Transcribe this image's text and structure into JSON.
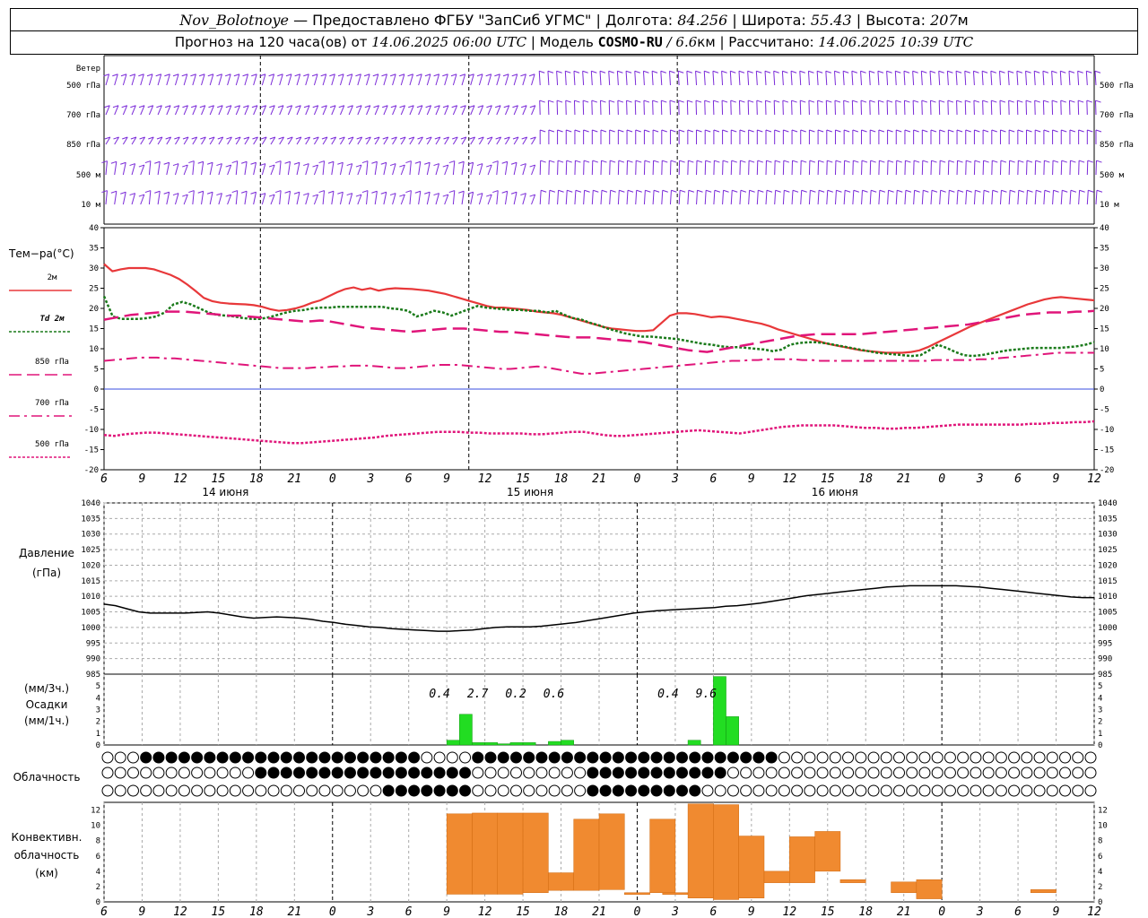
{
  "header": {
    "station": "Nov_Bolotnoye",
    "provider": " — Предоставлено ФГБУ \"ЗапСиб УГМС\" | Долгота: ",
    "lon": "84.256",
    "lat_label": " | Широта: ",
    "lat": "55.43",
    "alt_label": " | Высота: ",
    "alt": "207",
    "alt_unit": "м",
    "forecast_label": "Прогноз на 120 часа(ов) от ",
    "forecast_time": "14.06.2025 06:00 UTC",
    "model_label": " | Модель ",
    "model": "COSMO-RU",
    "model_res": " / 6.6",
    "model_res_unit": "км",
    "calc_label": " | Рассчитано: ",
    "calc_time": "14.06.2025 10:39 UTC"
  },
  "wind_panel": {
    "title": "Ветер",
    "levels": [
      "500 гПа",
      "700 гПа",
      "850 гПа",
      "500 м",
      "10  м"
    ],
    "color": "#7a2ad8"
  },
  "x_axis": {
    "hour_labels": [
      "6",
      "9",
      "12",
      "15",
      "18",
      "21",
      "0",
      "3",
      "6",
      "9",
      "12",
      "15",
      "18",
      "21",
      "0",
      "3",
      "6",
      "9",
      "12",
      "15",
      "18",
      "21",
      "0",
      "3",
      "6",
      "9",
      "12"
    ],
    "day_labels": [
      "14 июня",
      "15 июня",
      "16 июня"
    ]
  },
  "temperature_panel": {
    "title": "Тем−ра(°С)",
    "legend": [
      {
        "label": "2м",
        "color": "#e8383a",
        "style": "solid"
      },
      {
        "label": "Td  2м",
        "color": "#1a7a1a",
        "style": "dotted"
      },
      {
        "label": "850 гПа",
        "color": "#e0157a",
        "style": "dashed"
      },
      {
        "label": "700 гПа",
        "color": "#e0157a",
        "style": "dashdot"
      },
      {
        "label": "500 гПа",
        "color": "#e0157a",
        "style": "dense-dotted"
      }
    ],
    "ylim": [
      -20,
      40
    ],
    "yticks": [
      -20,
      -15,
      -10,
      -5,
      0,
      5,
      10,
      15,
      20,
      25,
      30,
      35,
      40
    ]
  },
  "pressure_panel": {
    "title": "Давление",
    "unit": "(гПа)",
    "ylim": [
      985,
      1040
    ],
    "yticks": [
      985,
      990,
      995,
      1000,
      1005,
      1010,
      1015,
      1020,
      1025,
      1030,
      1035,
      1040
    ]
  },
  "precip_panel": {
    "title_units_3h": "(мм/3ч.)",
    "title": "Осадки",
    "title_units_1h": "(мм/1ч.)",
    "ylim": [
      0,
      6
    ],
    "yticks": [
      0,
      1,
      2,
      3,
      4,
      5
    ],
    "totals": [
      {
        "x": 27,
        "text": "0.4"
      },
      {
        "x": 30,
        "text": "2.7"
      },
      {
        "x": 33,
        "text": "0.2"
      },
      {
        "x": 36,
        "text": "0.6"
      },
      {
        "x": 45,
        "text": "0.4"
      },
      {
        "x": 48,
        "text": "9.6"
      }
    ]
  },
  "cloud_panel": {
    "title": "Облачность"
  },
  "convective_panel": {
    "title_line1": "Конвективн.",
    "title_line2": "облачность",
    "title_line3": "(км)",
    "ylim": [
      0,
      13
    ],
    "yticks": [
      0,
      2,
      4,
      6,
      8,
      10,
      12
    ]
  },
  "chart_data": [
    {
      "type": "line",
      "title": "Тем−ра(°С)",
      "xlabel": "",
      "ylabel": "",
      "x_hours_from_start": [
        0,
        1,
        2,
        3,
        4,
        5,
        6,
        7,
        8,
        9,
        10,
        11,
        12,
        13,
        14,
        15,
        16,
        17,
        18,
        19,
        20,
        21,
        22,
        23,
        24,
        25,
        26,
        27,
        28,
        29,
        30,
        31,
        32,
        33,
        34,
        35,
        36,
        37,
        38,
        39,
        40,
        41,
        42,
        43,
        44,
        45,
        46,
        47,
        48,
        49,
        50,
        51,
        52,
        53,
        54,
        55,
        56,
        57,
        58,
        59,
        60,
        61,
        62,
        63,
        64,
        65,
        66,
        67,
        68,
        69,
        70,
        71,
        72,
        73,
        74,
        75,
        76,
        77,
        78,
        79,
        80,
        81,
        82,
        83,
        84,
        85,
        86,
        87,
        88,
        89,
        90,
        91,
        92,
        93,
        94,
        95,
        96,
        97,
        98,
        99,
        100,
        101,
        102,
        103,
        104,
        105,
        106,
        107,
        108,
        109,
        110,
        111,
        112,
        113,
        114,
        115,
        116,
        117,
        118,
        119,
        120,
        121,
        122,
        123,
        124,
        125,
        126,
        127,
        128,
        129,
        130,
        131,
        132,
        133,
        134,
        135,
        136,
        137,
        138,
        139,
        140,
        141,
        142,
        143,
        144,
        145,
        146,
        147,
        148,
        149,
        150,
        151,
        152,
        153,
        154,
        155,
        156,
        157,
        158,
        159
      ],
      "ylim": [
        -20,
        40
      ],
      "series": [
        {
          "name": "2м",
          "values": [
            31.0,
            29.2,
            29.7,
            30.0,
            30.0,
            30.0,
            29.7,
            29.0,
            28.3,
            27.3,
            25.9,
            24.3,
            22.6,
            21.8,
            21.4,
            21.2,
            21.1,
            21.0,
            20.8,
            20.4,
            19.8,
            19.4,
            19.6,
            20.0,
            20.6,
            21.4,
            22.0,
            23.0,
            24.0,
            24.8,
            25.2,
            24.6,
            25.0,
            24.4,
            24.8,
            25.0,
            24.9,
            24.8,
            24.6,
            24.4,
            24.0,
            23.6,
            23.0,
            22.4,
            21.8,
            21.2,
            20.6,
            20.2,
            20.2,
            20.0,
            19.8,
            19.6,
            19.2,
            19.0,
            18.8,
            18.4,
            17.8,
            17.2,
            16.6,
            16.0,
            15.4,
            15.0,
            14.8,
            14.6,
            14.4,
            14.4,
            14.6,
            16.4,
            18.2,
            18.8,
            18.8,
            18.6,
            18.2,
            17.8,
            18.0,
            17.8,
            17.4,
            17.0,
            16.6,
            16.2,
            15.6,
            14.8,
            14.2,
            13.6,
            13.0,
            12.4,
            11.8,
            11.2,
            10.8,
            10.4,
            10.0,
            9.6,
            9.4,
            9.2,
            9.0,
            9.0,
            9.0,
            9.2,
            9.6,
            10.4,
            11.4,
            12.4,
            13.4,
            14.4,
            15.4,
            16.2,
            17.0,
            17.8,
            18.6,
            19.4,
            20.2,
            21.0,
            21.6,
            22.2,
            22.6,
            22.8,
            22.6,
            22.4,
            22.2,
            22.0
          ]
        },
        {
          "name": "Td  2м",
          "values": [
            23.0,
            18.0,
            17.4,
            17.4,
            17.4,
            17.6,
            18.0,
            19.0,
            21.0,
            21.6,
            21.0,
            20.0,
            19.0,
            18.4,
            18.2,
            18.0,
            17.6,
            17.4,
            17.4,
            17.8,
            18.4,
            19.0,
            19.4,
            19.6,
            20.0,
            20.2,
            20.2,
            20.4,
            20.4,
            20.4,
            20.4,
            20.4,
            20.4,
            20.0,
            19.8,
            19.4,
            18.0,
            18.6,
            19.4,
            19.0,
            18.2,
            19.0,
            19.8,
            20.6,
            20.2,
            20.0,
            19.8,
            19.6,
            19.6,
            19.4,
            19.4,
            19.0,
            19.4,
            18.4,
            17.6,
            17.2,
            16.4,
            15.8,
            15.0,
            14.4,
            13.8,
            13.4,
            13.0,
            13.0,
            12.8,
            12.6,
            12.4,
            12.0,
            11.6,
            11.2,
            11.0,
            10.6,
            10.4,
            10.4,
            10.2,
            10.0,
            9.8,
            9.4,
            9.8,
            11.0,
            11.4,
            11.6,
            11.6,
            11.4,
            11.0,
            10.6,
            10.2,
            9.8,
            9.4,
            9.0,
            8.8,
            8.6,
            8.4,
            8.2,
            8.4,
            9.6,
            11.0,
            10.2,
            9.2,
            8.4,
            8.2,
            8.4,
            8.8,
            9.2,
            9.6,
            9.8,
            10.0,
            10.2,
            10.2,
            10.2,
            10.2,
            10.4,
            10.6,
            11.0,
            11.6
          ]
        },
        {
          "name": "850 гПа",
          "values": [
            17.2,
            17.6,
            18.0,
            18.4,
            18.6,
            18.8,
            19.0,
            19.2,
            19.2,
            19.2,
            19.0,
            18.8,
            18.6,
            18.4,
            18.2,
            18.2,
            18.0,
            17.8,
            17.6,
            17.4,
            17.2,
            17.0,
            16.8,
            16.8,
            17.0,
            16.8,
            16.4,
            16.0,
            15.6,
            15.2,
            15.0,
            14.8,
            14.6,
            14.4,
            14.2,
            14.4,
            14.6,
            14.8,
            15.0,
            15.0,
            15.0,
            14.8,
            14.6,
            14.4,
            14.2,
            14.2,
            14.0,
            13.8,
            13.6,
            13.4,
            13.2,
            13.0,
            12.8,
            12.8,
            12.8,
            12.6,
            12.4,
            12.2,
            12.0,
            11.8,
            11.6,
            11.2,
            10.8,
            10.4,
            10.0,
            9.6,
            9.4,
            9.2,
            9.6,
            10.0,
            10.4,
            10.8,
            11.2,
            11.6,
            12.0,
            12.4,
            12.8,
            13.2,
            13.4,
            13.6,
            13.6,
            13.6,
            13.6,
            13.6,
            13.6,
            13.8,
            14.0,
            14.2,
            14.4,
            14.6,
            14.8,
            15.0,
            15.2,
            15.4,
            15.6,
            15.8,
            16.0,
            16.4,
            16.8,
            17.2,
            17.6,
            18.0,
            18.4,
            18.6,
            18.8,
            19.0,
            19.0,
            19.0,
            19.2,
            19.2,
            19.4
          ]
        },
        {
          "name": "700 гПа",
          "values": [
            7.0,
            7.2,
            7.4,
            7.6,
            7.8,
            7.8,
            7.8,
            7.6,
            7.6,
            7.4,
            7.2,
            7.0,
            6.8,
            6.6,
            6.4,
            6.2,
            6.0,
            5.8,
            5.6,
            5.4,
            5.2,
            5.2,
            5.2,
            5.2,
            5.4,
            5.4,
            5.6,
            5.6,
            5.8,
            5.8,
            5.8,
            5.6,
            5.4,
            5.2,
            5.2,
            5.4,
            5.6,
            5.8,
            6.0,
            6.0,
            6.0,
            5.8,
            5.6,
            5.4,
            5.2,
            5.0,
            5.0,
            5.2,
            5.4,
            5.6,
            5.4,
            5.0,
            4.6,
            4.2,
            3.8,
            3.8,
            4.0,
            4.2,
            4.4,
            4.6,
            4.8,
            5.0,
            5.2,
            5.4,
            5.6,
            5.8,
            6.0,
            6.2,
            6.4,
            6.6,
            6.8,
            7.0,
            7.0,
            7.2,
            7.2,
            7.4,
            7.4,
            7.4,
            7.4,
            7.2,
            7.2,
            7.0,
            7.0,
            7.0,
            7.0,
            7.0,
            7.0,
            7.0,
            7.0,
            7.0,
            7.0,
            7.0,
            7.0,
            7.0,
            7.2,
            7.2,
            7.2,
            7.2,
            7.2,
            7.4,
            7.4,
            7.6,
            7.8,
            8.0,
            8.2,
            8.4,
            8.6,
            8.8,
            9.0,
            9.0,
            9.0,
            9.0,
            9.0
          ]
        },
        {
          "name": "500 гПа",
          "values": [
            -11.4,
            -11.6,
            -11.2,
            -11.0,
            -10.8,
            -10.8,
            -11.0,
            -11.2,
            -11.4,
            -11.6,
            -11.8,
            -12.0,
            -12.2,
            -12.4,
            -12.6,
            -12.8,
            -13.0,
            -13.2,
            -13.4,
            -13.4,
            -13.2,
            -13.0,
            -12.8,
            -12.6,
            -12.4,
            -12.2,
            -12.0,
            -11.6,
            -11.4,
            -11.2,
            -11.0,
            -10.8,
            -10.6,
            -10.6,
            -10.6,
            -10.8,
            -10.8,
            -11.0,
            -11.0,
            -11.0,
            -11.0,
            -11.2,
            -11.2,
            -11.0,
            -10.8,
            -10.6,
            -10.6,
            -11.0,
            -11.4,
            -11.6,
            -11.6,
            -11.4,
            -11.2,
            -11.0,
            -10.8,
            -10.6,
            -10.4,
            -10.2,
            -10.4,
            -10.6,
            -10.8,
            -11.0,
            -10.6,
            -10.2,
            -9.8,
            -9.4,
            -9.2,
            -9.0,
            -9.0,
            -9.0,
            -9.0,
            -9.2,
            -9.4,
            -9.6,
            -9.6,
            -9.8,
            -9.8,
            -9.6,
            -9.6,
            -9.4,
            -9.2,
            -9.0,
            -8.8,
            -8.8,
            -8.8,
            -8.8,
            -8.8,
            -8.8,
            -8.8,
            -8.6,
            -8.6,
            -8.4,
            -8.4,
            -8.2,
            -8.2,
            -8.0
          ]
        }
      ]
    },
    {
      "type": "line",
      "title": "Давление",
      "ylabel": "(гПа)",
      "ylim": [
        985,
        1040
      ],
      "series": [
        {
          "name": "",
          "values": [
            1007.5,
            1007.0,
            1006.0,
            1005.0,
            1004.6,
            1004.6,
            1004.6,
            1004.6,
            1004.8,
            1005.0,
            1004.6,
            1004.0,
            1003.4,
            1003.0,
            1003.2,
            1003.4,
            1003.2,
            1003.0,
            1002.6,
            1002.0,
            1001.6,
            1001.0,
            1000.6,
            1000.2,
            1000.0,
            999.6,
            999.4,
            999.2,
            999.0,
            998.8,
            998.8,
            999.0,
            999.2,
            999.6,
            1000.0,
            1000.2,
            1000.2,
            1000.2,
            1000.4,
            1000.8,
            1001.2,
            1001.6,
            1002.2,
            1002.8,
            1003.4,
            1004.0,
            1004.6,
            1005.0,
            1005.4,
            1005.6,
            1005.8,
            1006.0,
            1006.2,
            1006.4,
            1006.8,
            1007.0,
            1007.4,
            1007.8,
            1008.4,
            1009.0,
            1009.6,
            1010.2,
            1010.6,
            1011.0,
            1011.4,
            1011.8,
            1012.2,
            1012.6,
            1013.0,
            1013.2,
            1013.4,
            1013.4,
            1013.4,
            1013.4,
            1013.4,
            1013.2,
            1013.0,
            1012.6,
            1012.2,
            1011.8,
            1011.4,
            1011.0,
            1010.6,
            1010.2,
            1009.8,
            1009.6,
            1009.6
          ]
        }
      ]
    },
    {
      "type": "bar",
      "title": "Осадки",
      "ylim": [
        0,
        6
      ],
      "x_hours_from_start": [
        24,
        25,
        26,
        27,
        28,
        29,
        30,
        31,
        32,
        33,
        34,
        35,
        36,
        37,
        38,
        46,
        47,
        48,
        49,
        50,
        51
      ],
      "values": [
        0,
        0,
        0,
        0.4,
        2.6,
        0.2,
        0.2,
        0.1,
        0.2,
        0.2,
        0,
        0.3,
        0.4,
        0,
        0,
        0.4,
        0,
        5.8,
        2.4,
        0,
        0
      ]
    },
    {
      "type": "bar",
      "title": "Конвективн. облачность",
      "ylabel": "(км)",
      "ylim": [
        0,
        13
      ],
      "x_hours_from_start": [
        27,
        29,
        31,
        33,
        35,
        37,
        39,
        41,
        43,
        44,
        46,
        48,
        50,
        52,
        54,
        56,
        58,
        62,
        64,
        73
      ],
      "bottoms": [
        1.0,
        1.0,
        1.0,
        1.2,
        1.5,
        1.5,
        1.6,
        1.2,
        1.2,
        2.5,
        0.5,
        0.3,
        0.5,
        2.5,
        2.5,
        4.0,
        2.5,
        1.2,
        0.4,
        1.2
      ],
      "tops": [
        11.5,
        11.6,
        11.6,
        11.6,
        3.8,
        10.8,
        11.5,
        1.2,
        10.8,
        1.2,
        12.8,
        12.7,
        8.6,
        4.0,
        8.5,
        9.2,
        2.9,
        2.6,
        2.9,
        1.6
      ]
    }
  ]
}
